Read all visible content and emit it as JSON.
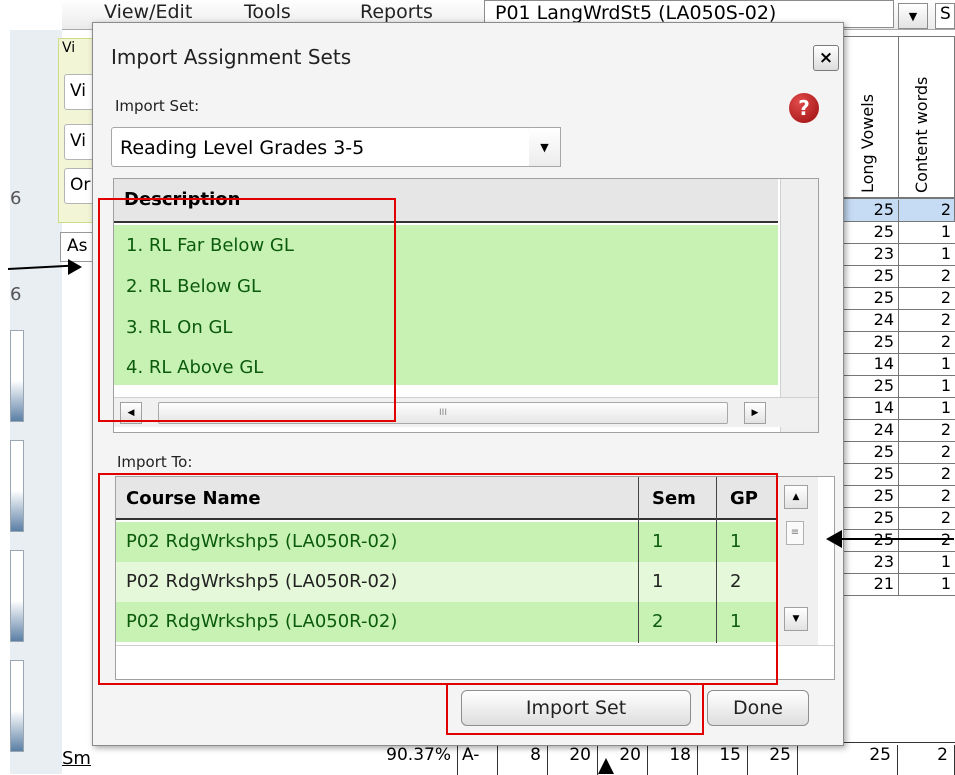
{
  "menubar": {
    "items": [
      "View/Edit",
      "Tools",
      "Reports"
    ],
    "course_select": "P01  LangWrdSt5 (LA050S-02)",
    "small_select": "S"
  },
  "background": {
    "view_buttons": [
      "Vi",
      "Vi",
      "Or"
    ],
    "view_header": "Vi",
    "side_numbers": [
      "6",
      "6"
    ],
    "assignment_tab": "As",
    "summary_label": "Sm",
    "grid_headers": [
      "Long Vowels",
      "Content words"
    ],
    "grid_max": [
      "25",
      "2"
    ],
    "grid_rows": [
      [
        "25",
        "1"
      ],
      [
        "23",
        "1"
      ],
      [
        "25",
        "2"
      ],
      [
        "25",
        "2"
      ],
      [
        "24",
        "2"
      ],
      [
        "25",
        "2"
      ],
      [
        "14",
        "1"
      ],
      [
        "25",
        "1"
      ],
      [
        "14",
        "1"
      ],
      [
        "24",
        "2"
      ],
      [
        "25",
        "2"
      ],
      [
        "25",
        "2"
      ],
      [
        "25",
        "2"
      ],
      [
        "25",
        "2"
      ],
      [
        "25",
        "2"
      ],
      [
        "23",
        "1"
      ],
      [
        "21",
        "1"
      ]
    ],
    "summary_values": [
      "90.37%",
      "A-",
      "8",
      "20",
      "20",
      "18",
      "15",
      "25",
      "25",
      "2"
    ]
  },
  "dialog": {
    "title": "Import Assignment Sets",
    "close_label": "×",
    "import_set_label": "Import Set:",
    "help_glyph": "?",
    "selected_set": "Reading Level Grades 3-5",
    "description_header": "Description",
    "descriptions": [
      "1. RL Far Below GL",
      "2. RL Below GL",
      "3. RL On GL",
      "4. RL Above GL"
    ],
    "scroll_grip": "III",
    "import_to_label": "Import To:",
    "columns": {
      "course": "Course Name",
      "sem": "Sem",
      "gp": "GP"
    },
    "courses": [
      {
        "name": "P02  RdgWrkshp5 (LA050R-02)",
        "sem": "1",
        "gp": "1",
        "color": "#c8f2b4",
        "text_color": "#0b5b0b"
      },
      {
        "name": "P02  RdgWrkshp5 (LA050R-02)",
        "sem": "1",
        "gp": "2",
        "color": "#e6f8da",
        "text_color": "#222222"
      },
      {
        "name": "P02  RdgWrkshp5 (LA050R-02)",
        "sem": "2",
        "gp": "1",
        "color": "#c8f2b4",
        "text_color": "#0b5b0b"
      }
    ],
    "import_button": "Import Set",
    "done_button": "Done"
  },
  "colors": {
    "selected_row": "#c8f2b4",
    "annotation_red": "#e00000",
    "help_red": "#b51c1c"
  }
}
